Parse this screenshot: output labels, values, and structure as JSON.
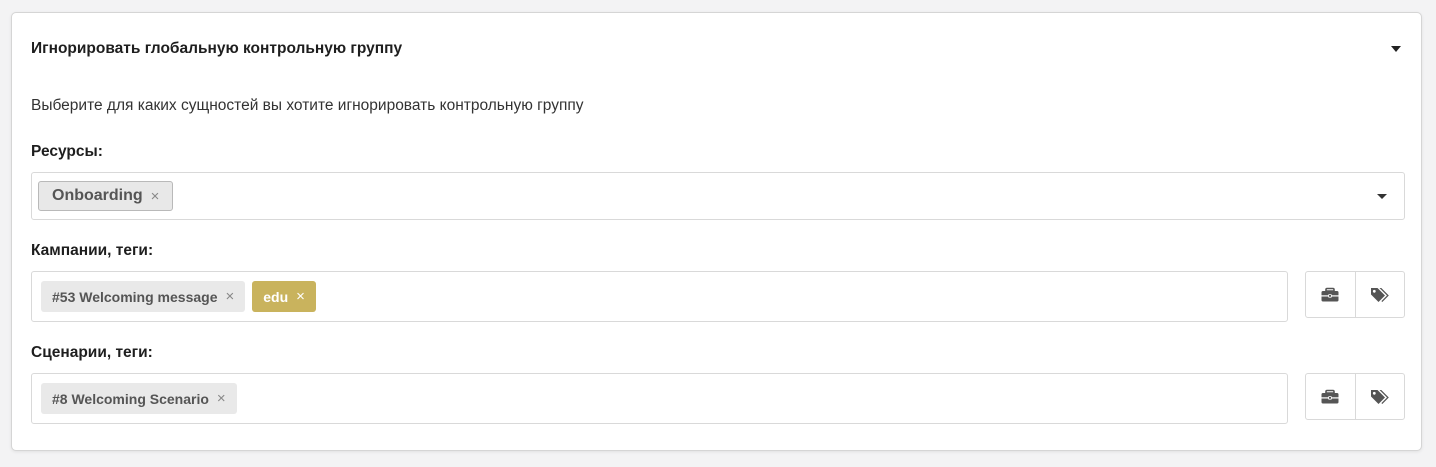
{
  "section": {
    "title": "Игнорировать глобальную контрольную группу",
    "description": "Выберите для каких сущностей вы хотите игнорировать контрольную группу"
  },
  "resources": {
    "label": "Ресурсы:",
    "selected": [
      {
        "label": "Onboarding",
        "remove": "×"
      }
    ]
  },
  "campaigns": {
    "label": "Кампании, теги:",
    "chips": [
      {
        "label": "#53 Welcoming message",
        "remove": "×",
        "color": "#e9e9e9"
      },
      {
        "label": "edu",
        "remove": "×",
        "color": "#c9b35d"
      }
    ],
    "buttons": [
      "briefcase-icon",
      "tags-icon"
    ]
  },
  "scenarios": {
    "label": "Сценарии, теги:",
    "chips": [
      {
        "label": "#8 Welcoming Scenario",
        "remove": "×",
        "color": "#e9e9e9"
      }
    ],
    "buttons": [
      "briefcase-icon",
      "tags-icon"
    ]
  },
  "colors": {
    "tag_gold": "#c9b35d",
    "chip_gray": "#e9e9e9",
    "border": "#d9d9d9"
  }
}
